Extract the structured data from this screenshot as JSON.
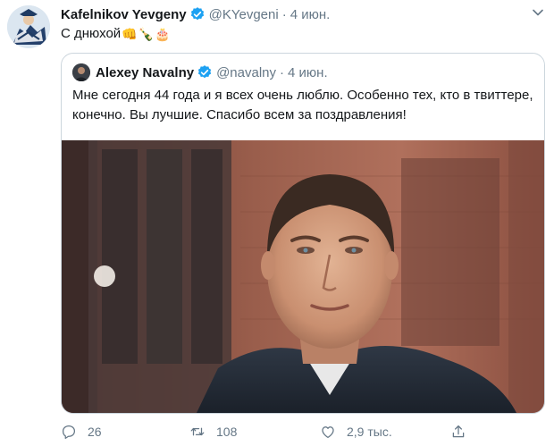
{
  "tweet": {
    "author_name": "Kafelnikov Yevgeny",
    "handle": "@KYevgeni",
    "separator": "·",
    "date": "4 июн.",
    "text": "С днюхой",
    "emojis": [
      "👊",
      "🍾",
      "🎂"
    ]
  },
  "quoted": {
    "author_name": "Alexey Navalny",
    "handle": "@navalny",
    "separator": "·",
    "date": "4 июн.",
    "text": "Мне сегодня 44 года и я всех очень люблю. Особенно тех, кто в твиттере, конечно. Вы лучшие. Спасибо всем за поздравления!"
  },
  "actions": {
    "replies": "26",
    "retweets": "108",
    "likes": "2,9 тыс."
  },
  "colors": {
    "verified": "#1da1f2",
    "muted": "#657786",
    "border": "#ccd6dd"
  }
}
